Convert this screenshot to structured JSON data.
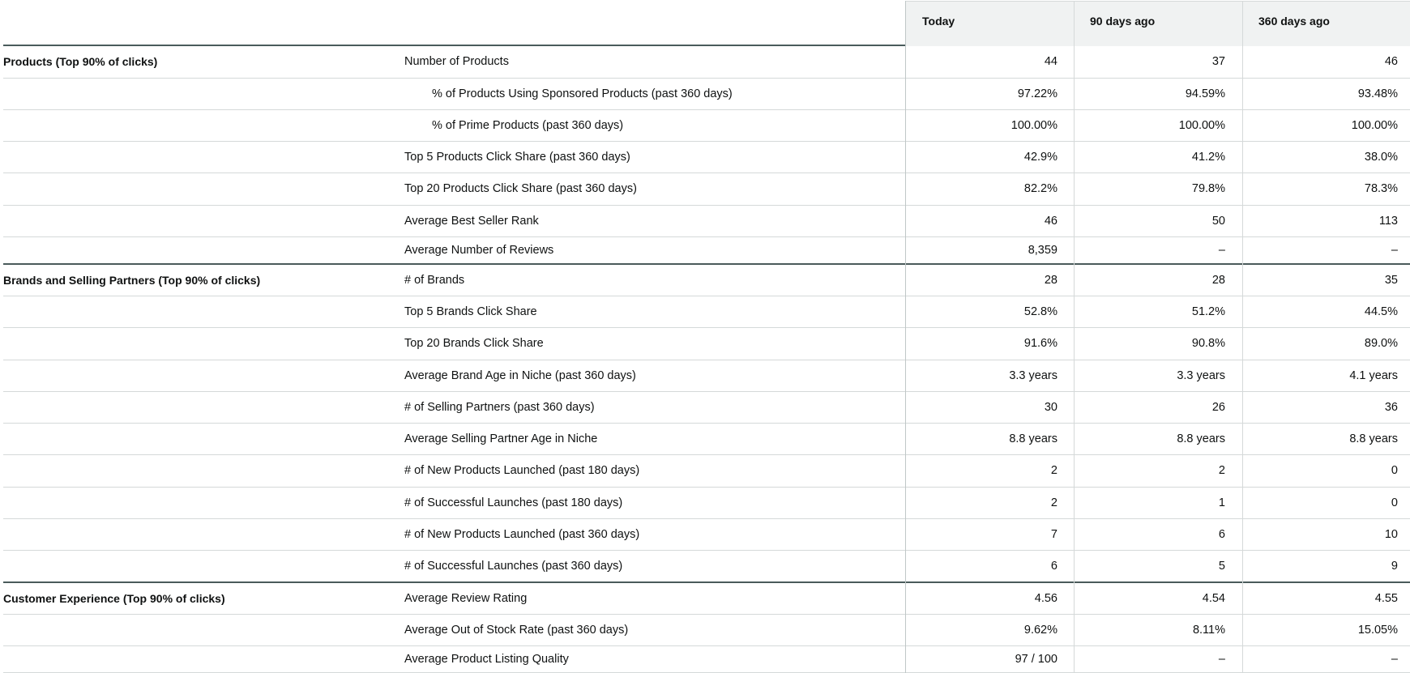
{
  "columns": [
    "Today",
    "90 days ago",
    "360 days ago"
  ],
  "rows": [
    {
      "category": "Products (Top 90% of clicks)",
      "metric": "Number of Products",
      "indent": false,
      "values": [
        "44",
        "37",
        "46"
      ]
    },
    {
      "category": "",
      "metric": "% of Products Using Sponsored Products (past 360 days)",
      "indent": true,
      "values": [
        "97.22%",
        "94.59%",
        "93.48%"
      ]
    },
    {
      "category": "",
      "metric": "% of Prime Products (past 360 days)",
      "indent": true,
      "values": [
        "100.00%",
        "100.00%",
        "100.00%"
      ]
    },
    {
      "category": "",
      "metric": "Top 5 Products Click Share (past 360 days)",
      "indent": false,
      "values": [
        "42.9%",
        "41.2%",
        "38.0%"
      ]
    },
    {
      "category": "",
      "metric": "Top 20 Products Click Share (past 360 days)",
      "indent": false,
      "values": [
        "82.2%",
        "79.8%",
        "78.3%"
      ]
    },
    {
      "category": "",
      "metric": "Average Best Seller Rank",
      "indent": false,
      "values": [
        "46",
        "50",
        "113"
      ]
    },
    {
      "category": "",
      "metric": "Average Number of Reviews",
      "indent": false,
      "values": [
        "8,359",
        "–",
        "–"
      ]
    },
    {
      "category": "Brands and Selling Partners (Top 90% of clicks)",
      "metric": "# of Brands",
      "indent": false,
      "values": [
        "28",
        "28",
        "35"
      ]
    },
    {
      "category": "",
      "metric": "Top 5 Brands Click Share",
      "indent": false,
      "values": [
        "52.8%",
        "51.2%",
        "44.5%"
      ]
    },
    {
      "category": "",
      "metric": "Top 20 Brands Click Share",
      "indent": false,
      "values": [
        "91.6%",
        "90.8%",
        "89.0%"
      ]
    },
    {
      "category": "",
      "metric": "Average Brand Age in Niche (past 360 days)",
      "indent": false,
      "values": [
        "3.3 years",
        "3.3 years",
        "4.1 years"
      ]
    },
    {
      "category": "",
      "metric": "# of Selling Partners (past 360 days)",
      "indent": false,
      "values": [
        "30",
        "26",
        "36"
      ]
    },
    {
      "category": "",
      "metric": "Average Selling Partner Age in Niche",
      "indent": false,
      "values": [
        "8.8 years",
        "8.8 years",
        "8.8 years"
      ]
    },
    {
      "category": "",
      "metric": "# of New Products Launched (past 180 days)",
      "indent": false,
      "values": [
        "2",
        "2",
        "0"
      ]
    },
    {
      "category": "",
      "metric": "# of Successful Launches (past 180 days)",
      "indent": false,
      "values": [
        "2",
        "1",
        "0"
      ]
    },
    {
      "category": "",
      "metric": "# of New Products Launched (past 360 days)",
      "indent": false,
      "values": [
        "7",
        "6",
        "10"
      ]
    },
    {
      "category": "",
      "metric": "# of Successful Launches (past 360 days)",
      "indent": false,
      "values": [
        "6",
        "5",
        "9"
      ]
    },
    {
      "category": "Customer Experience (Top 90% of clicks)",
      "metric": "Average Review Rating",
      "indent": false,
      "values": [
        "4.56",
        "4.54",
        "4.55"
      ]
    },
    {
      "category": "",
      "metric": "Average Out of Stock Rate (past 360 days)",
      "indent": false,
      "values": [
        "9.62%",
        "8.11%",
        "15.05%"
      ]
    },
    {
      "category": "",
      "metric": "Average Product Listing Quality",
      "indent": false,
      "values": [
        "97 / 100",
        "–",
        "–"
      ]
    }
  ]
}
